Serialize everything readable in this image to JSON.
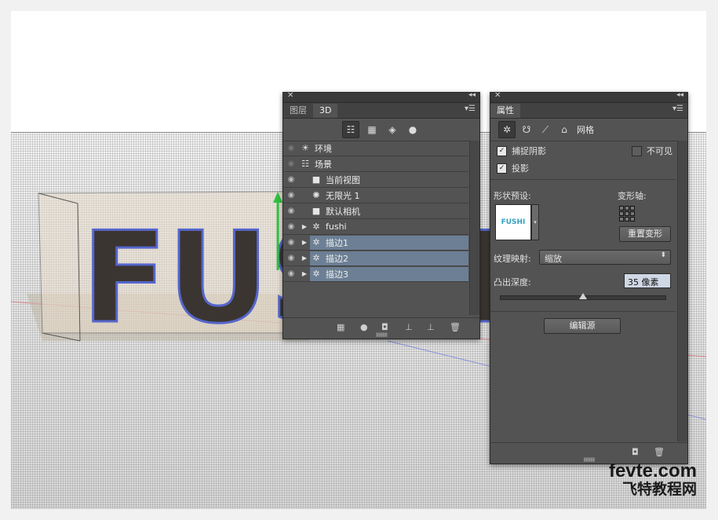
{
  "layers_panel": {
    "tabs": [
      "图层",
      "3D"
    ],
    "active_tab": "3D",
    "rows": [
      {
        "label": "环境",
        "icon": "environment-icon",
        "visible_dim": true,
        "expand": false,
        "selected": false,
        "indent": 0
      },
      {
        "label": "场景",
        "icon": "scene-icon",
        "visible_dim": true,
        "expand": false,
        "selected": false,
        "indent": 0
      },
      {
        "label": "当前视图",
        "icon": "camera-icon",
        "visible_dim": false,
        "expand": false,
        "selected": false,
        "indent": 1
      },
      {
        "label": "无限光 1",
        "icon": "light-icon",
        "visible_dim": false,
        "expand": false,
        "selected": false,
        "indent": 1
      },
      {
        "label": "默认相机",
        "icon": "camera-icon",
        "visible_dim": false,
        "expand": false,
        "selected": false,
        "indent": 1
      },
      {
        "label": "fushi",
        "icon": "mesh-icon",
        "visible_dim": false,
        "expand": true,
        "selected": false,
        "indent": 1
      },
      {
        "label": "描边1",
        "icon": "mesh-icon",
        "visible_dim": false,
        "expand": true,
        "selected": true,
        "indent": 1
      },
      {
        "label": "描边2",
        "icon": "mesh-icon",
        "visible_dim": false,
        "expand": true,
        "selected": true,
        "indent": 1
      },
      {
        "label": "描边3",
        "icon": "mesh-icon",
        "visible_dim": false,
        "expand": true,
        "selected": true,
        "indent": 1
      }
    ]
  },
  "properties_panel": {
    "tab": "属性",
    "mesh_label": "网格",
    "catch_shadows": "捕捉阴影",
    "invisible": "不可见",
    "cast_shadows": "投影",
    "shape_preset": "形状预设:",
    "deform_axis": "变形轴:",
    "reset_deform": "重置变形",
    "texture_mapping_label": "纹理映射:",
    "texture_mapping_value": "缩放",
    "extrusion_depth_label": "凸出深度:",
    "extrusion_depth_value": "35 像素",
    "extrusion_slider": 0.5,
    "edit_source": "编辑源",
    "preset_thumb_text": "FUSHI"
  },
  "scene": {
    "text": "FUSHI"
  },
  "watermark": {
    "site": "fevte.com",
    "name": "飞特教程网"
  }
}
